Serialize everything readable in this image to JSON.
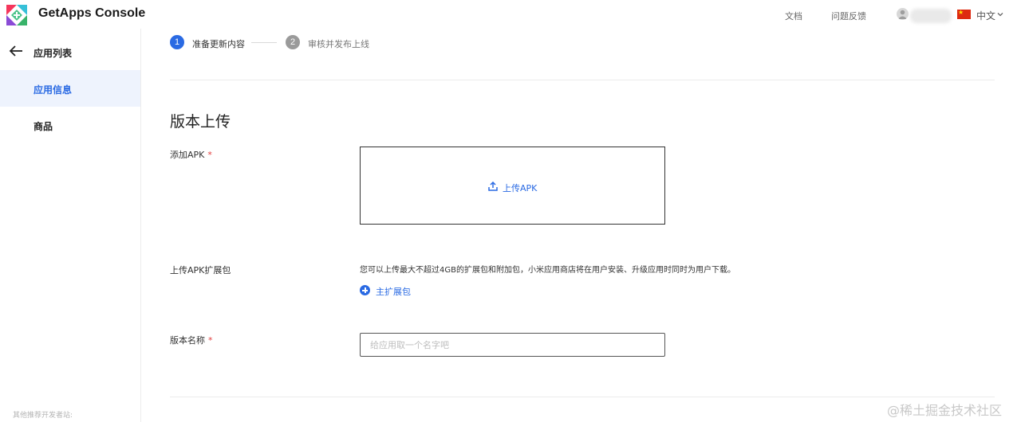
{
  "header": {
    "app_title": "GetApps Console",
    "docs_label": "文档",
    "feedback_label": "问题反馈",
    "language_label": "中文",
    "logo_icon": "getapps-logo-icon",
    "avatar_icon": "user-avatar-icon",
    "flag_icon": "china-flag-icon"
  },
  "sidebar": {
    "back_label": "应用列表",
    "items": [
      {
        "label": "应用信息",
        "active": true
      },
      {
        "label": "商品",
        "active": false
      }
    ],
    "footer_text": "其他推荐开发者站:"
  },
  "steps": [
    {
      "number": "1",
      "label": "准备更新内容",
      "status": "active"
    },
    {
      "number": "2",
      "label": "审核并发布上线",
      "status": "pending"
    }
  ],
  "form": {
    "section_title": "版本上传",
    "add_apk_label": "添加APK",
    "required_mark": "*",
    "upload_apk_button": "上传APK",
    "expansion_label": "上传APK扩展包",
    "expansion_hint": "您可以上传最大不超过4GB的扩展包和附加包，小米应用商店将在用户安装、升级应用时同时为用户下载。",
    "add_main_expansion_label": "主扩展包",
    "version_name_label": "版本名称",
    "version_name_placeholder": "给应用取一个名字吧",
    "version_name_value": ""
  },
  "watermark": "@稀土掘金技术社区",
  "colors": {
    "accent": "#2a6ae3",
    "required": "#e23b3b",
    "sidebar_active_bg": "#eef3fd"
  }
}
